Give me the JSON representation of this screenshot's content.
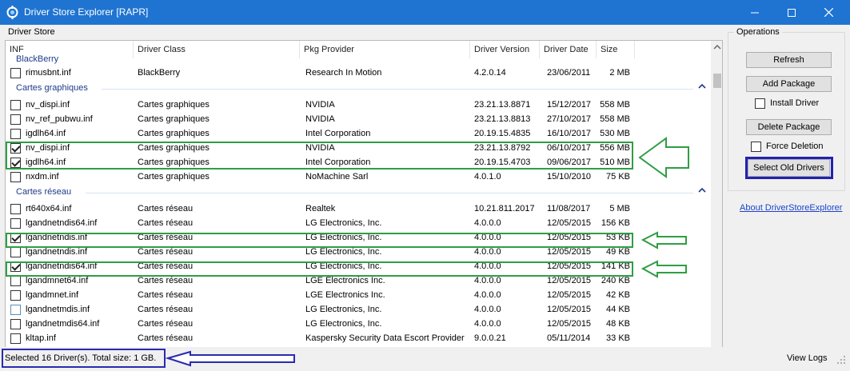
{
  "window": {
    "title": "Driver Store Explorer [RAPR]"
  },
  "store_label": "Driver Store",
  "columns": [
    "INF",
    "Driver Class",
    "Pkg Provider",
    "Driver Version",
    "Driver Date",
    "Size"
  ],
  "partial_group_label": "BlackBerry",
  "groups": [
    {
      "name": "BlackBerry",
      "rows": [
        {
          "inf": "rimusbnt.inf",
          "class": "BlackBerry",
          "provider": "Research In Motion",
          "version": "4.2.0.14",
          "date": "23/06/2011",
          "size": "2 MB",
          "checked": false
        }
      ]
    },
    {
      "name": "Cartes graphiques",
      "rows": [
        {
          "inf": "nv_dispi.inf",
          "class": "Cartes graphiques",
          "provider": "NVIDIA",
          "version": "23.21.13.8871",
          "date": "15/12/2017",
          "size": "558 MB",
          "checked": false
        },
        {
          "inf": "nv_ref_pubwu.inf",
          "class": "Cartes graphiques",
          "provider": "NVIDIA",
          "version": "23.21.13.8813",
          "date": "27/10/2017",
          "size": "558 MB",
          "checked": false
        },
        {
          "inf": "igdlh64.inf",
          "class": "Cartes graphiques",
          "provider": "Intel Corporation",
          "version": "20.19.15.4835",
          "date": "16/10/2017",
          "size": "530 MB",
          "checked": false
        },
        {
          "inf": "nv_dispi.inf",
          "class": "Cartes graphiques",
          "provider": "NVIDIA",
          "version": "23.21.13.8792",
          "date": "06/10/2017",
          "size": "556 MB",
          "checked": true
        },
        {
          "inf": "igdlh64.inf",
          "class": "Cartes graphiques",
          "provider": "Intel Corporation",
          "version": "20.19.15.4703",
          "date": "09/06/2017",
          "size": "510 MB",
          "checked": true
        },
        {
          "inf": "nxdm.inf",
          "class": "Cartes graphiques",
          "provider": "NoMachine Sarl",
          "version": "4.0.1.0",
          "date": "15/10/2010",
          "size": "75 KB",
          "checked": false
        }
      ]
    },
    {
      "name": "Cartes réseau",
      "rows": [
        {
          "inf": "rt640x64.inf",
          "class": "Cartes réseau",
          "provider": "Realtek",
          "version": "10.21.811.2017",
          "date": "11/08/2017",
          "size": "5 MB",
          "checked": false
        },
        {
          "inf": "lgandnetndis64.inf",
          "class": "Cartes réseau",
          "provider": "LG Electronics, Inc.",
          "version": "4.0.0.0",
          "date": "12/05/2015",
          "size": "156 KB",
          "checked": false
        },
        {
          "inf": "lgandnetndis.inf",
          "class": "Cartes réseau",
          "provider": "LG Electronics, Inc.",
          "version": "4.0.0.0",
          "date": "12/05/2015",
          "size": "53 KB",
          "checked": true
        },
        {
          "inf": "lgandnetndis.inf",
          "class": "Cartes réseau",
          "provider": "LG Electronics, Inc.",
          "version": "4.0.0.0",
          "date": "12/05/2015",
          "size": "49 KB",
          "checked": false
        },
        {
          "inf": "lgandnetndis64.inf",
          "class": "Cartes réseau",
          "provider": "LG Electronics, Inc.",
          "version": "4.0.0.0",
          "date": "12/05/2015",
          "size": "141 KB",
          "checked": true
        },
        {
          "inf": "lgandmnet64.inf",
          "class": "Cartes réseau",
          "provider": "LGE Electronics Inc.",
          "version": "4.0.0.0",
          "date": "12/05/2015",
          "size": "240 KB",
          "checked": false
        },
        {
          "inf": "lgandmnet.inf",
          "class": "Cartes réseau",
          "provider": "LGE Electronics Inc.",
          "version": "4.0.0.0",
          "date": "12/05/2015",
          "size": "42 KB",
          "checked": false
        },
        {
          "inf": "lgandnetmdis.inf",
          "class": "Cartes réseau",
          "provider": "LG Electronics, Inc.",
          "version": "4.0.0.0",
          "date": "12/05/2015",
          "size": "44 KB",
          "checked": false
        },
        {
          "inf": "lgandnetmdis64.inf",
          "class": "Cartes réseau",
          "provider": "LG Electronics, Inc.",
          "version": "4.0.0.0",
          "date": "12/05/2015",
          "size": "48 KB",
          "checked": false
        },
        {
          "inf": "kltap.inf",
          "class": "Cartes réseau",
          "provider": "Kaspersky Security Data Escort Provider",
          "version": "9.0.0.21",
          "date": "05/11/2014",
          "size": "33 KB",
          "checked": false
        }
      ]
    }
  ],
  "operations": {
    "label": "Operations",
    "refresh": "Refresh",
    "add_package": "Add Package",
    "install_driver": "Install Driver",
    "delete_package": "Delete Package",
    "force_deletion": "Force Deletion",
    "select_old_drivers": "Select Old Drivers"
  },
  "about_link": "About DriverStoreExplorer",
  "status": {
    "text": "Selected 16 Driver(s). Total size: 1 GB.",
    "view_logs": "View Logs"
  },
  "colors": {
    "titlebar": "#1f74d1",
    "highlight_green": "#2f9e44",
    "highlight_blue": "#2a2ab0",
    "link": "#1a44c9"
  }
}
